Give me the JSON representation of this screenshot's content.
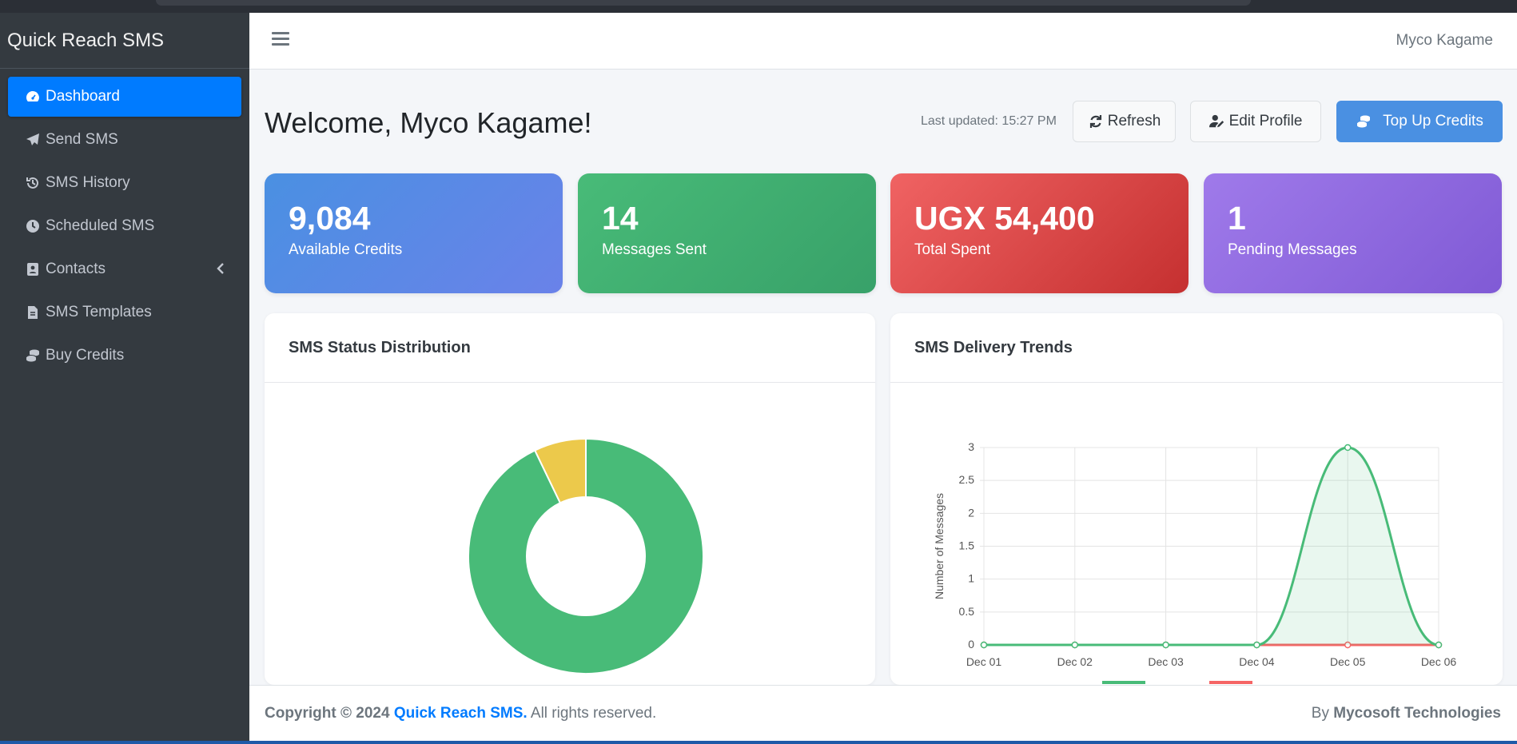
{
  "app": {
    "brand": "Quick Reach SMS"
  },
  "sidebar": {
    "items": [
      {
        "label": "Dashboard",
        "icon": "gauge-icon",
        "active": true
      },
      {
        "label": "Send SMS",
        "icon": "paper-plane-icon"
      },
      {
        "label": "SMS History",
        "icon": "history-icon"
      },
      {
        "label": "Scheduled SMS",
        "icon": "clock-icon"
      },
      {
        "label": "Contacts",
        "icon": "address-book-icon",
        "has_submenu": true
      },
      {
        "label": "SMS Templates",
        "icon": "file-icon"
      },
      {
        "label": "Buy Credits",
        "icon": "coins-icon"
      }
    ]
  },
  "header": {
    "user_name": "Myco Kagame"
  },
  "main": {
    "welcome": "Welcome, Myco Kagame!",
    "last_updated": "Last updated: 15:27 PM",
    "buttons": {
      "refresh": "Refresh",
      "edit_profile": "Edit Profile",
      "top_up": "Top Up Credits"
    },
    "stats": [
      {
        "value": "9,084",
        "label": "Available Credits",
        "color": "#4a90e2"
      },
      {
        "value": "14",
        "label": "Messages Sent",
        "color": "#48bb78"
      },
      {
        "value": "UGX 54,400",
        "label": "Total Spent",
        "color": "#e53e3e"
      },
      {
        "value": "1",
        "label": "Pending Messages",
        "color": "#9f7aea"
      }
    ],
    "cards": {
      "status_title": "SMS Status Distribution",
      "trend_title": "SMS Delivery Trends"
    }
  },
  "footer": {
    "copyright_prefix": "Copyright © 2024",
    "brand_link": "Quick Reach SMS.",
    "rights": "All rights reserved.",
    "by_prefix": "By",
    "company": "Mycosoft Technologies"
  },
  "chart_data": [
    {
      "type": "pie",
      "donut": true,
      "title": "",
      "slices": [
        {
          "value": 13,
          "color": "#48bb78"
        },
        {
          "value": 1,
          "color": "#ecc94b"
        }
      ]
    },
    {
      "type": "line",
      "title": "",
      "x": [
        "Dec 01",
        "Dec 02",
        "Dec 03",
        "Dec 04",
        "Dec 05",
        "Dec 06"
      ],
      "ylabel": "Number of Messages",
      "ylim": [
        0,
        3
      ],
      "yticks": [
        "0",
        "0.5",
        "1",
        "1.5",
        "2",
        "2.5",
        "3"
      ],
      "grid": true,
      "series": [
        {
          "values": [
            0,
            0,
            0,
            0,
            3,
            0
          ],
          "color": "#48bb78",
          "fill": true
        },
        {
          "values": [
            0,
            0,
            0,
            0,
            0,
            0
          ],
          "color": "#f56565",
          "fill": false
        }
      ]
    }
  ]
}
